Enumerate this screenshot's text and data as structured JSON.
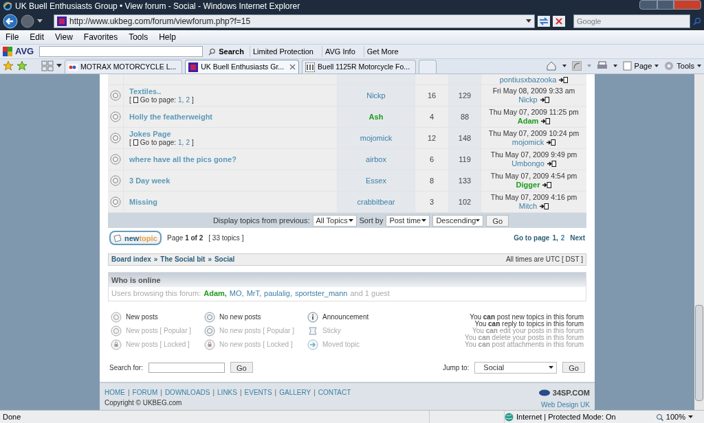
{
  "window": {
    "title": "UK Buell Enthusiasts Group • View forum - Social - Windows Internet Explorer"
  },
  "address_bar": {
    "url": "http://www.ukbeg.com/forum/viewforum.php?f=15"
  },
  "web_search": {
    "placeholder": "Google"
  },
  "menu": [
    "File",
    "Edit",
    "View",
    "Favorites",
    "Tools",
    "Help"
  ],
  "avg_toolbar": {
    "brand": "AVG",
    "search_button": "Search",
    "items": [
      "Limited Protection",
      "AVG Info",
      "Get More"
    ]
  },
  "tabs": [
    {
      "label": "MOTRAX MOTORCYCLE L...",
      "selected": false
    },
    {
      "label": "UK Buell Enthusiasts Gr...",
      "selected": true
    },
    {
      "label": "Buell 1125R Motorcycle Fo...",
      "selected": false
    }
  ],
  "command_bar": [
    "Page",
    "Tools"
  ],
  "topics": [
    {
      "last_post_author": {
        "name": "pontiusxbazooka",
        "color": "#3a7fa6"
      }
    },
    {
      "title": "Textiles..",
      "pages_open": "[",
      "pages_close": "]",
      "pages_label": "Go to page:",
      "pages": [
        "1,",
        "2"
      ],
      "author": {
        "name": "Nickp",
        "color": "#3a7fa6"
      },
      "replies": "16",
      "views": "129",
      "last_post_date": "Fri May 08, 2009 9:33 am",
      "last_post_author": {
        "name": "Nickp",
        "color": "#3a7fa6"
      }
    },
    {
      "title": "Holly the featherweight",
      "author": {
        "name": "Ash",
        "color": "#1f9a1f"
      },
      "replies": "4",
      "views": "88",
      "last_post_date": "Thu May 07, 2009 11:25 pm",
      "last_post_author": {
        "name": "Adam",
        "color": "#1f9a1f"
      }
    },
    {
      "title": "Jokes Page",
      "pages_open": "[",
      "pages_close": "]",
      "pages_label": "Go to page:",
      "pages": [
        "1,",
        "2"
      ],
      "author": {
        "name": "mojomick",
        "color": "#3a7fa6"
      },
      "replies": "12",
      "views": "148",
      "last_post_date": "Thu May 07, 2009 10:24 pm",
      "last_post_author": {
        "name": "mojomick",
        "color": "#3a7fa6"
      }
    },
    {
      "title": "where have all the pics gone?",
      "author": {
        "name": "airbox",
        "color": "#3a7fa6"
      },
      "replies": "6",
      "views": "119",
      "last_post_date": "Thu May 07, 2009 9:49 pm",
      "last_post_author": {
        "name": "Umbongo",
        "color": "#3a7fa6"
      }
    },
    {
      "title": "3 Day week",
      "author": {
        "name": "Essex",
        "color": "#3a7fa6"
      },
      "replies": "8",
      "views": "133",
      "last_post_date": "Thu May 07, 2009 4:54 pm",
      "last_post_author": {
        "name": "Digger",
        "color": "#1f9a1f"
      }
    },
    {
      "title": "Missing",
      "author": {
        "name": "crabbitbear",
        "color": "#3a7fa6"
      },
      "replies": "3",
      "views": "102",
      "last_post_date": "Thu May 07, 2009 4:16 pm",
      "last_post_author": {
        "name": "Mitch",
        "color": "#3a7fa6"
      }
    }
  ],
  "display_filter": {
    "label": "Display topics from previous:",
    "period": "All Topics",
    "sort_label": "Sort by",
    "sort_key": "Post time",
    "order": "Descending",
    "go": "Go"
  },
  "new_topic_button": {
    "part1": "new",
    "part2": "topic"
  },
  "page_info": "Page **1 of 2**",
  "topic_count": "[ 33 topics ]",
  "pagination": {
    "label": "Go to page",
    "pages": [
      {
        "label": "1,",
        "selected": true
      },
      {
        "label": "2",
        "selected": false
      }
    ],
    "next": "Next"
  },
  "breadcrumb": {
    "items": [
      "Board index",
      "The Social bit",
      "Social"
    ],
    "separator": "»",
    "timezone": "All times are UTC [ DST ]"
  },
  "who_is_online": {
    "title": "Who is online",
    "prefix": "Users browsing this forum:",
    "users": [
      {
        "name": "Adam,",
        "color": "#1f9a1f"
      },
      {
        "name": "MO,",
        "color": "#3a7fa6"
      },
      {
        "name": "MrT,",
        "color": "#3a7fa6"
      },
      {
        "name": "paulalig,",
        "color": "#3a7fa6"
      },
      {
        "name": "sportster_mann",
        "color": "#3a7fa6"
      }
    ],
    "suffix": "and 1 guest"
  },
  "legend": [
    {
      "kind": "new",
      "label": "New posts"
    },
    {
      "kind": "no_new",
      "label": "No new posts"
    },
    {
      "kind": "announcement",
      "label": "Announcement"
    },
    {
      "kind": "new",
      "label": "New posts [ Popular ]"
    },
    {
      "kind": "no_new",
      "label": "No new posts [ Popular ]"
    },
    {
      "kind": "sticky",
      "label": "Sticky"
    },
    {
      "kind": "locked",
      "label": "New posts [ Locked ]"
    },
    {
      "kind": "locked",
      "label": "No new posts [ Locked ]"
    },
    {
      "kind": "moved",
      "label": "Moved topic"
    }
  ],
  "permissions": [
    "You **can** post new topics in this forum",
    "You **can** reply to topics in this forum",
    "You **can** edit your posts in this forum",
    "You **can** delete your posts in this forum",
    "You **can** post attachments in this forum"
  ],
  "search": {
    "label": "Search for:",
    "go": "Go"
  },
  "jump": {
    "label": "Jump to:",
    "value": "Social",
    "go": "Go"
  },
  "footer": {
    "links": [
      "HOME",
      "FORUM",
      "DOWNLOADS",
      "LINKS",
      "EVENTS",
      "GALLERY",
      "CONTACT"
    ],
    "separator": "|",
    "copyright": "Copyright © UKBEG.com",
    "host": "34SP.COM",
    "host_sub": "Web Design UK"
  },
  "status_bar": {
    "text": "Done",
    "zone": "Internet | Protected Mode: On",
    "zoom": "100%"
  }
}
